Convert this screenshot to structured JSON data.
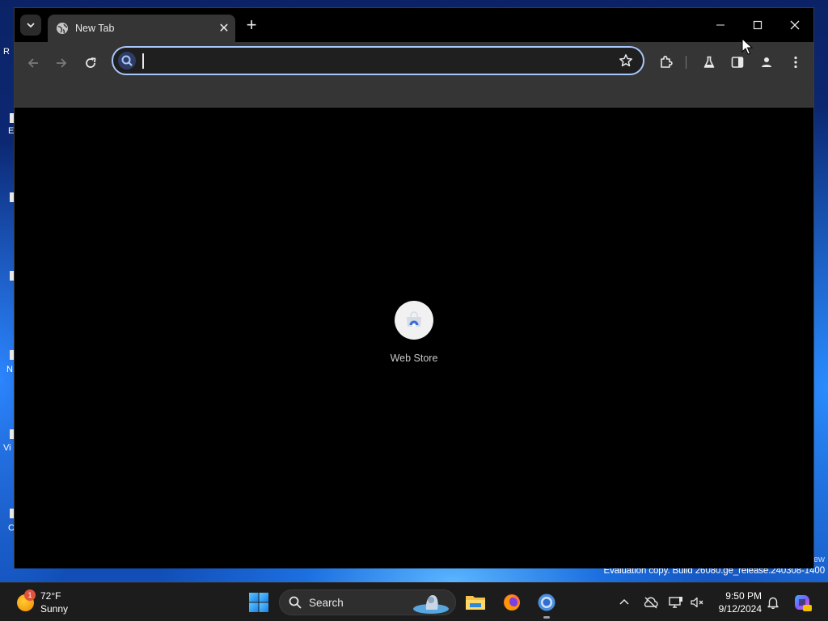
{
  "browser": {
    "tab": {
      "title": "New Tab",
      "close_glyph": "✕"
    },
    "new_tab_glyph": "+",
    "tab_search_glyph": "▾",
    "omnibox": {
      "value": "",
      "placeholder": ""
    },
    "window_controls": {
      "minimize": "─",
      "maximize": "□",
      "close": "✕"
    }
  },
  "newtab": {
    "shortcuts": [
      {
        "label": "Web Store",
        "icon": "web-store-icon"
      }
    ]
  },
  "desktop": {
    "watermark": "Evaluation copy. Build 26080.ge_release.240308-1400",
    "watermark_fragment": "ew",
    "label_fragments": [
      "R",
      "E",
      "N",
      "Vi",
      "C"
    ]
  },
  "taskbar": {
    "weather": {
      "temp": "72°F",
      "condition": "Sunny",
      "badge": "1"
    },
    "search": {
      "label": "Search"
    },
    "clock": {
      "time": "9:50 PM",
      "date": "9/12/2024"
    }
  },
  "colors": {
    "accent": "#a8c7fa",
    "toolbar_bg": "#353535",
    "taskbar_bg": "#1c1c1c"
  }
}
